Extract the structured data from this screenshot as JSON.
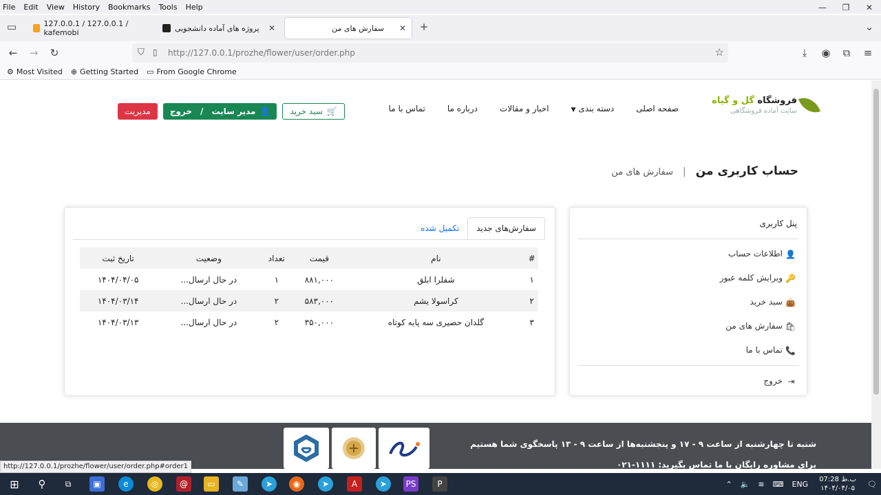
{
  "browser": {
    "menu": [
      "File",
      "Edit",
      "View",
      "History",
      "Bookmarks",
      "Tools",
      "Help"
    ],
    "tabs": [
      {
        "label": "127.0.0.1 / 127.0.0.1 / kafemobi"
      },
      {
        "label": "پروژه های آماده دانشجویی"
      },
      {
        "label": "سفارش های من"
      }
    ],
    "url_host": "http://127.0.0.1",
    "url_path": "/prozhe/flower/user/order.php",
    "bookmarks": [
      "Most Visited",
      "Getting Started",
      "From Google Chrome"
    ],
    "status_url": "http://127.0.0.1/prozhe/flower/user/order.php#order1"
  },
  "site": {
    "logo_name_1": "فروشگاه",
    "logo_name_2": "گل و گیاه",
    "logo_sub": "سایت آماده فروشگاهی",
    "nav": [
      "صفحه اصلی",
      "دسته بندی",
      "اخبار و مقالات",
      "درباره ما",
      "تماس با ما"
    ],
    "cart_button": "سبد خرید",
    "user_button": "مدیر سایت",
    "user_sep": "/",
    "logout_button": "خروج",
    "admin_button": "مدیریت"
  },
  "breadcrumb": {
    "title": "حساب کاربری من",
    "sep": "|",
    "current": "سفارش های من"
  },
  "user_panel": {
    "title": "پنل کاربری",
    "items": [
      "اطلاعات حساب",
      "ویرایش کلمه عبور",
      "سبد خرید",
      "سفارش های من",
      "تماس با ما"
    ],
    "logout": "خروج"
  },
  "orders": {
    "tab_new": "سفارش‌های جدید",
    "tab_done": "تکمیل شده",
    "headers": [
      "#",
      "نام",
      "قیمت",
      "تعداد",
      "وضعیت",
      "تاریخ ثبت"
    ],
    "rows": [
      [
        "۱",
        "شفلرا ابلق",
        "۸۸۱,۰۰۰",
        "۱",
        "در حال ارسال...",
        "۱۴۰۴/۰۴/۰۵"
      ],
      [
        "۲",
        "کراسولا یشم",
        "۵۸۳,۰۰۰",
        "۲",
        "در حال ارسال...",
        "۱۴۰۴/۰۳/۱۴"
      ],
      [
        "۳",
        "گلدان حصیری سه پایه کوتاه",
        "۳۵۰,۰۰۰",
        "۲",
        "در حال ارسال...",
        "۱۴۰۴/۰۳/۱۳"
      ]
    ]
  },
  "footer": {
    "hours": "شنبه تا چهارشنبه از ساعت ۹ - ۱۷ و پنجشنبه‌ها از ساعت ۹ - ۱۳ پاسخگوی شما هستیم",
    "consult": "برای مشاوره رایگان با ما تماس بگیرید: ۱۱۱۱-۰۲۱"
  },
  "taskbar": {
    "lang": "ENG",
    "time": "07:28 ب.ظ",
    "date": "۱۴۰۴/۰۴/۰۵"
  },
  "colors": {
    "green": "#198754",
    "red": "#dc3545",
    "status": "#f0a020",
    "link": "#0d6efd",
    "footer": "#4a4d52"
  }
}
